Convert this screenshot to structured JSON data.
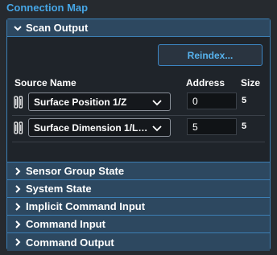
{
  "title": "Connection Map",
  "scan_output": {
    "label": "Scan Output",
    "reindex_label": "Reindex...",
    "columns": {
      "source_name": "Source Name",
      "address": "Address",
      "size": "Size"
    },
    "rows": [
      {
        "source": "Surface Position 1/Z",
        "address": "0",
        "size": "5"
      },
      {
        "source": "Surface Dimension 1/Len...",
        "address": "5",
        "size": "5"
      }
    ]
  },
  "collapsed_sections": [
    "Sensor Group State",
    "System State",
    "Implicit Command Input",
    "Command Input",
    "Command Output"
  ],
  "colors": {
    "accent": "#46a6e6",
    "header_bg": "#2d4860",
    "border": "#3c7fb5",
    "panel_bg": "#1f242a"
  }
}
